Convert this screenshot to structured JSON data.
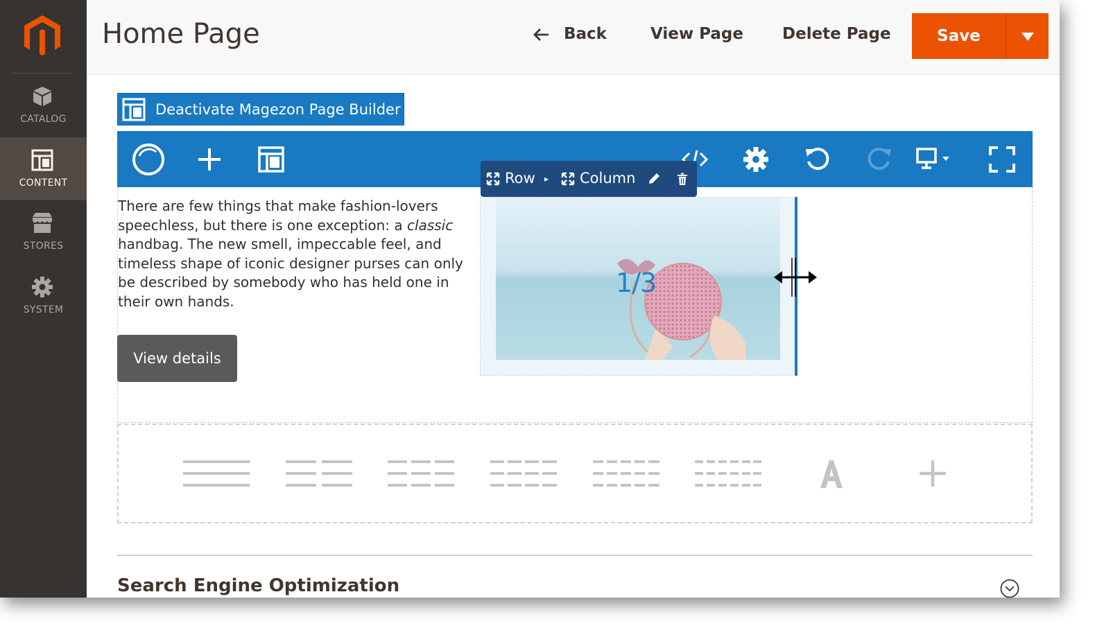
{
  "sidebar": {
    "items": [
      {
        "label": "CATALOG",
        "icon": "cube-icon"
      },
      {
        "label": "CONTENT",
        "icon": "layout-icon"
      },
      {
        "label": "STORES",
        "icon": "store-icon"
      },
      {
        "label": "SYSTEM",
        "icon": "gear-icon"
      }
    ]
  },
  "header": {
    "title": "Home Page",
    "back_label": "Back",
    "view_label": "View Page",
    "delete_label": "Delete Page",
    "save_label": "Save"
  },
  "builder": {
    "deactivate_label": "Deactivate Magezon Page Builder",
    "intro_before": "There are few things that make fashion-lovers speechless, but there is one exception: a ",
    "intro_emphasis": "classic",
    "intro_after": " handbag. The new smell, impeccable feel, and timeless shape of iconic designer purses can only be described by somebody who has held one in their own hands.",
    "view_details_label": "View details",
    "column_size": "1/3",
    "control_bar": {
      "row_label": "Row",
      "column_label": "Column"
    }
  },
  "seo": {
    "title": "Search Engine Optimization"
  },
  "colors": {
    "accent": "#eb5202",
    "builder_blue": "#1979c3",
    "sidebar_bg": "#373330",
    "sidebar_active": "#514943"
  }
}
